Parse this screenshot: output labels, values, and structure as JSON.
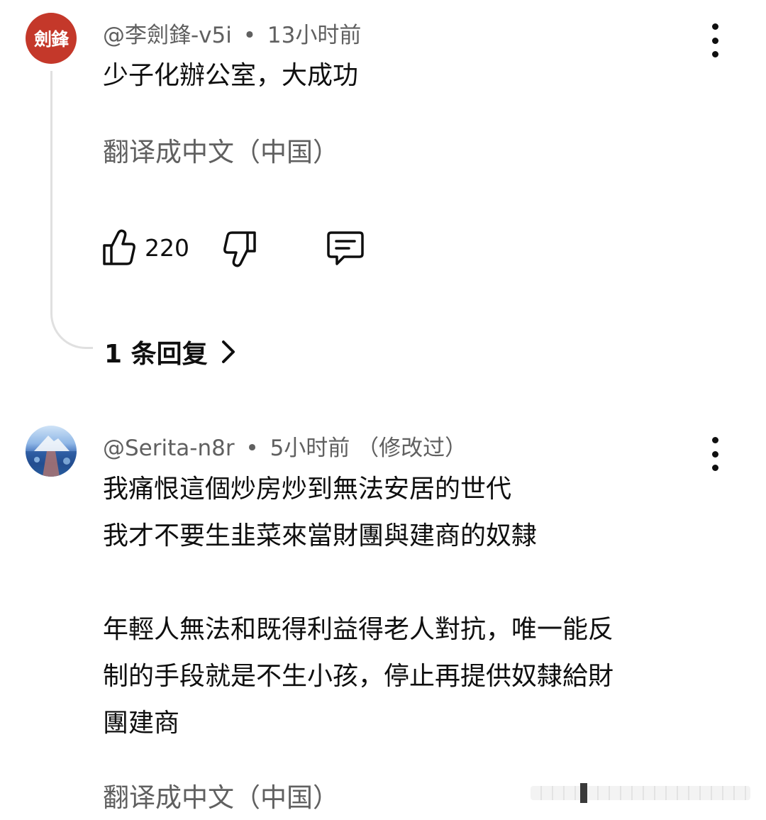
{
  "comments": [
    {
      "avatar_text": "劍鋒",
      "author": "@李劍鋒-v5i",
      "separator": "•",
      "time": "13小时前",
      "edited": "",
      "lines": [
        "少子化辦公室，大成功"
      ],
      "translate_label": "翻译成中文（中国）",
      "like_count": "220",
      "replies_label": "1 条回复"
    },
    {
      "author": "@Serita-n8r",
      "separator": "•",
      "time": "5小时前",
      "edited": "（修改过）",
      "lines": [
        "我痛恨這個炒房炒到無法安居的世代",
        "我才不要生韭菜來當財團與建商的奴隸",
        "",
        "年輕人無法和既得利益得老人對抗，唯一能反",
        "制的手段就是不生小孩，停止再提供奴隸給財",
        "團建商"
      ],
      "translate_label": "翻译成中文（中国）"
    }
  ],
  "icons": {
    "like": "thumbs-up-icon",
    "dislike": "thumbs-down-icon",
    "reply": "comment-icon",
    "more": "more-vertical-icon",
    "chevron": "chevron-right-icon"
  },
  "colors": {
    "avatar_red": "#c4382a",
    "meta_gray": "#606060",
    "text": "#0f0f0f"
  }
}
